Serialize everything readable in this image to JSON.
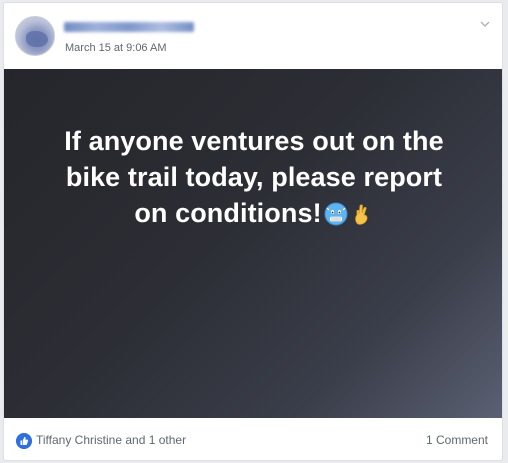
{
  "post": {
    "timestamp": "March 15 at 9:06 AM",
    "text_lines": [
      "If anyone ventures out on the",
      "bike trail today, please report",
      "on conditions!"
    ],
    "emojis": [
      "cold-face-icon",
      "crossed-fingers-icon"
    ]
  },
  "footer": {
    "reactors": "Tiffany Christine and 1 other",
    "comments": "1 Comment"
  },
  "colors": {
    "like_blue": "#2f6fe0",
    "post_bg_dark": "#25262b",
    "post_bg_light": "#5b6073"
  }
}
